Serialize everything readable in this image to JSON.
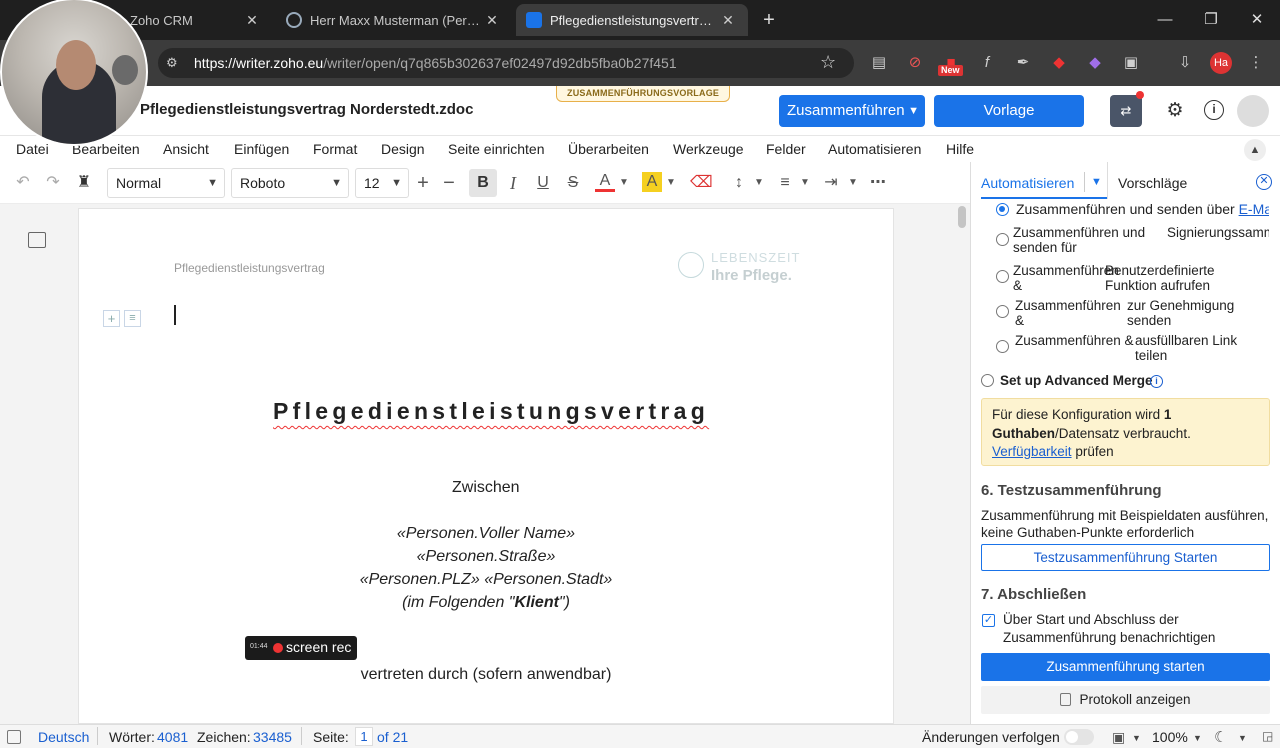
{
  "browser": {
    "tabs": [
      {
        "title": "Zoho CRM",
        "close": "✕"
      },
      {
        "title": "Herr Maxx Musterman (Personen",
        "close": "✕"
      },
      {
        "title": "Pflegedienstleistungsvertrag Norderstedt.zdoc",
        "close": "✕"
      }
    ],
    "new_tab": "+",
    "url_domain": "https://writer.zoho.eu",
    "url_path": "/writer/open/q7q865b302637ef02497d92db5fba0b27f451",
    "new_badge": "New",
    "profile_initials": "Ha"
  },
  "app": {
    "doc_title": "Pflegedienstleistungsvertrag Norderstedt.zdoc",
    "merge_template_badge": "ZUSAMMENFÜHRUNGSVORLAGE",
    "merge_button": "Zusammenführen",
    "update_template_button": "Vorlage aktualisieren"
  },
  "menu": [
    "Datei",
    "Bearbeiten",
    "Ansicht",
    "Einfügen",
    "Format",
    "Design",
    "Seite einrichten",
    "Überarbeiten",
    "Werkzeuge",
    "Felder",
    "Automatisieren",
    "Hilfe"
  ],
  "toolbar": {
    "style": "Normal",
    "font": "Roboto",
    "size": "12"
  },
  "document": {
    "header_text": "Pflegedienstleistungsvertrag",
    "logo_line1": "LEBENSZEIT",
    "logo_line2": "Ihre Pflege.",
    "heading": "Pflegedienstleistungsvertrag",
    "between": "Zwischen",
    "field1": "«Personen.Voller Name»",
    "field2": "«Personen.Straße»",
    "field3": "«Personen.PLZ» «Personen.Stadt»",
    "following_pre": "(im Folgenden \"",
    "following_bold": "Klient",
    "following_post": "\")",
    "represented": "vertreten durch (sofern anwendbar)"
  },
  "recorder": {
    "time": "01:44",
    "label": "screen rec"
  },
  "panel": {
    "tab_automate": "Automatisieren",
    "tab_suggestions": "Vorschläge",
    "options": [
      {
        "a": "Zusammenführen und senden über",
        "link": "E-Mail",
        "selected": true
      },
      {
        "a": "Zusammenführen und senden für",
        "b": "Signierungssammlung",
        "selected": false
      },
      {
        "a": "Zusammenführen &",
        "b": "Benutzerdefinierte Funktion aufrufen",
        "selected": false
      },
      {
        "a": "Zusammenführen &",
        "b": "zur Genehmigung senden",
        "selected": false
      },
      {
        "a": "Zusammenführen &",
        "b": "ausfüllbaren Link teilen",
        "selected": false
      }
    ],
    "advanced": "Set up Advanced Merge",
    "notice_pre": "Für diese Konfiguration wird ",
    "notice_bold": "1 Guthaben",
    "notice_mid": "/Datensatz verbraucht.",
    "notice_link": "Verfügbarkeit",
    "notice_post": " prüfen",
    "test_heading": "6. Testzusammenführung",
    "test_desc": "Zusammenführung mit Beispieldaten ausführen, keine Guthaben-Punkte erforderlich",
    "test_button": "Testzusammenführung Starten",
    "finish_heading": "7. Abschließen",
    "notify_label": "Über Start und Abschluss der Zusammenführung benachrichtigen",
    "notify_checked": true,
    "start_button": "Zusammenführung starten",
    "log_button": "Protokoll anzeigen"
  },
  "status": {
    "language": "Deutsch",
    "words_label": "Wörter:",
    "words": "4081",
    "chars_label": "Zeichen:",
    "chars": "33485",
    "page_label": "Seite:",
    "page_current": "1",
    "page_total": "of 21",
    "track_changes": "Änderungen verfolgen",
    "zoom": "100%"
  },
  "colors": {
    "accent": "#1a73e8",
    "notice_bg": "#fdf3d0",
    "tabbar": "#1f1f1f"
  }
}
